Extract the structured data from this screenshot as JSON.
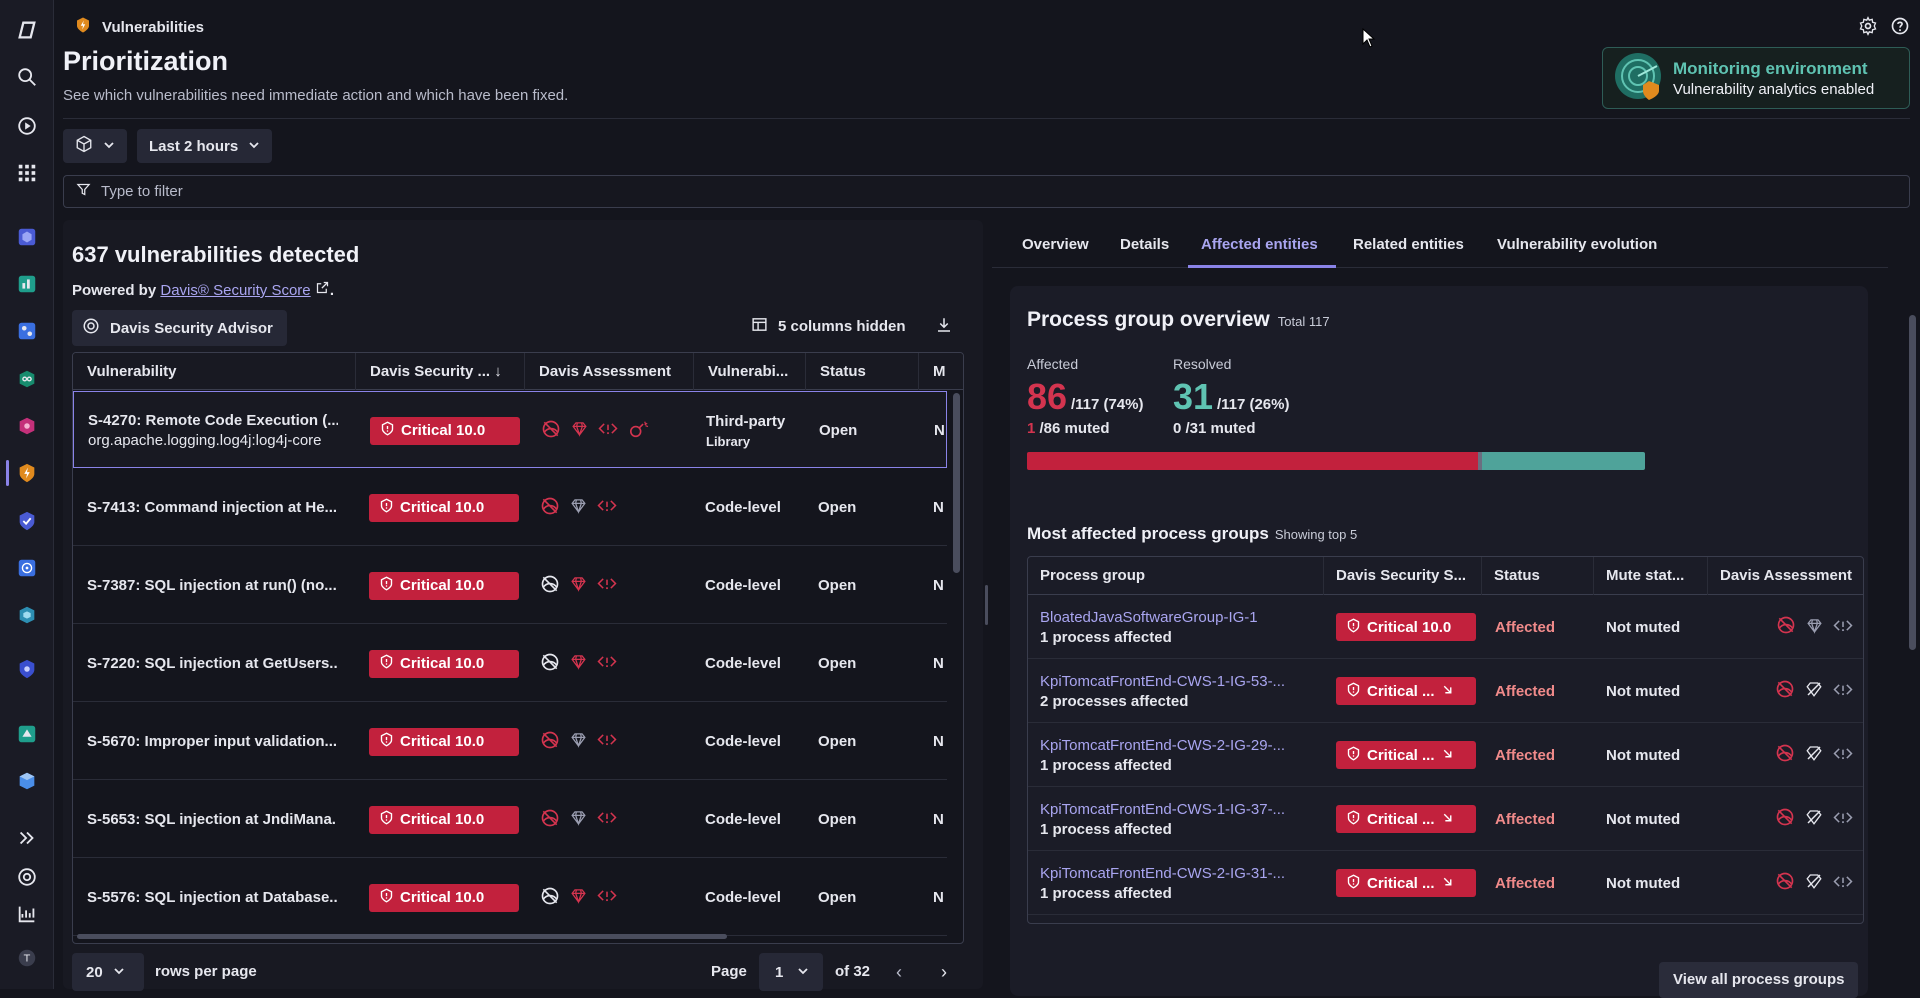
{
  "app": {
    "title": "Vulnerabilities"
  },
  "header": {
    "title": "Prioritization",
    "subtitle": "See which vulnerabilities need immediate action and which have been fixed."
  },
  "monitoring": {
    "title": "Monitoring environment",
    "subtitle": "Vulnerability analytics enabled"
  },
  "toolbar": {
    "timeframe": "Last 2 hours",
    "filter_placeholder": "Type to filter"
  },
  "list": {
    "title": "637 vulnerabilities detected",
    "powered_prefix": "Powered by",
    "powered_link": "Davis® Security Score",
    "powered_suffix": ".",
    "advisor_button": "Davis Security Advisor",
    "columns_hidden": "5 columns hidden",
    "columns": [
      "Vulnerability",
      "Davis Security ...",
      "Davis Assessment",
      "Vulnerabi...",
      "Status",
      "M"
    ],
    "rows": [
      {
        "name": "S-4270: Remote Code Execution (...",
        "sub": "org.apache.logging.log4j:log4j-core",
        "score": "Critical 10.0",
        "type": "Third-party",
        "type_sub": "Library",
        "status": "Open",
        "m": "N"
      },
      {
        "name": "S-7413: Command injection at He...",
        "sub": "",
        "score": "Critical 10.0",
        "type": "Code-level",
        "type_sub": "",
        "status": "Open",
        "m": "N"
      },
      {
        "name": "S-7387: SQL injection at run() (no...",
        "sub": "",
        "score": "Critical 10.0",
        "type": "Code-level",
        "type_sub": "",
        "status": "Open",
        "m": "N"
      },
      {
        "name": "S-7220: SQL injection at GetUsers...",
        "sub": "",
        "score": "Critical 10.0",
        "type": "Code-level",
        "type_sub": "",
        "status": "Open",
        "m": "N"
      },
      {
        "name": "S-5670: Improper input validation...",
        "sub": "",
        "score": "Critical 10.0",
        "type": "Code-level",
        "type_sub": "",
        "status": "Open",
        "m": "N"
      },
      {
        "name": "S-5653: SQL injection at JndiMana...",
        "sub": "",
        "score": "Critical 10.0",
        "type": "Code-level",
        "type_sub": "",
        "status": "Open",
        "m": "N"
      },
      {
        "name": "S-5576: SQL injection at Database...",
        "sub": "",
        "score": "Critical 10.0",
        "type": "Code-level",
        "type_sub": "",
        "status": "Open",
        "m": "N"
      }
    ],
    "pager": {
      "rows_value": "20",
      "rows_label": "rows per page",
      "page_label": "Page",
      "page_value": "1",
      "of_label": "of 32"
    }
  },
  "detail": {
    "tabs": [
      "Overview",
      "Details",
      "Affected entities",
      "Related entities",
      "Vulnerability evolution"
    ],
    "active_tab": "Affected entities",
    "overview_title": "Process group overview",
    "overview_total": "Total 117",
    "affected": {
      "label": "Affected",
      "count": "86",
      "fraction": "/117 (74%)",
      "muted_count": "1",
      "muted_label": "/86 muted",
      "share": 0.735
    },
    "resolved": {
      "label": "Resolved",
      "count": "31",
      "fraction": "/117 (26%)",
      "muted_count": "0",
      "muted_label": "/31 muted",
      "share": 0.265
    },
    "most_affected_title": "Most affected process groups",
    "most_affected_sub": "Showing top 5",
    "columns": [
      "Process group",
      "Davis Security S...",
      "Status",
      "Mute stat...",
      "Davis Assessment"
    ],
    "rows": [
      {
        "name": "BloatedJavaSoftwareGroup-IG-1",
        "sub": "1 process affected",
        "score": "Critical 10.0",
        "status": "Affected",
        "mute": "Not muted"
      },
      {
        "name": "KpiTomcatFrontEnd-CWS-1-IG-53-...",
        "sub": "2 processes affected",
        "score": "Critical ...",
        "status": "Affected",
        "mute": "Not muted"
      },
      {
        "name": "KpiTomcatFrontEnd-CWS-2-IG-29-...",
        "sub": "1 process affected",
        "score": "Critical ...",
        "status": "Affected",
        "mute": "Not muted"
      },
      {
        "name": "KpiTomcatFrontEnd-CWS-1-IG-37-...",
        "sub": "1 process affected",
        "score": "Critical ...",
        "status": "Affected",
        "mute": "Not muted"
      },
      {
        "name": "KpiTomcatFrontEnd-CWS-2-IG-31-...",
        "sub": "1 process affected",
        "score": "Critical ...",
        "status": "Affected",
        "mute": "Not muted"
      }
    ],
    "view_all": "View all process groups"
  },
  "colors": {
    "critical": "#c2213d",
    "affected": "#c2213d",
    "resolved": "#4fa39a",
    "accent": "#8a83e8",
    "link": "#a9a5f0"
  }
}
